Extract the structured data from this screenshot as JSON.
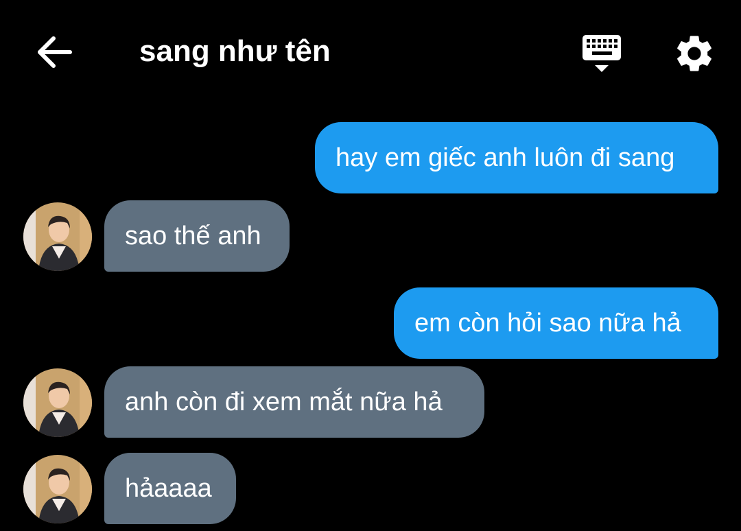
{
  "header": {
    "title": "sang như tên",
    "icons": {
      "back": "arrow-left-icon",
      "keyboard": "keyboard-icon",
      "settings": "gear-icon"
    }
  },
  "colors": {
    "background": "#000000",
    "sent_bubble": "#1d9bf0",
    "received_bubble": "#5f7080"
  },
  "messages": [
    {
      "from": "me",
      "text": "hay em giếc anh luôn đi sang"
    },
    {
      "from": "them",
      "text": "sao thế anh"
    },
    {
      "from": "me",
      "text": "em còn hỏi sao nữa hả"
    },
    {
      "from": "them",
      "text": "anh còn đi xem mắt nữa hả"
    },
    {
      "from": "them",
      "text": "hảaaaa"
    }
  ]
}
